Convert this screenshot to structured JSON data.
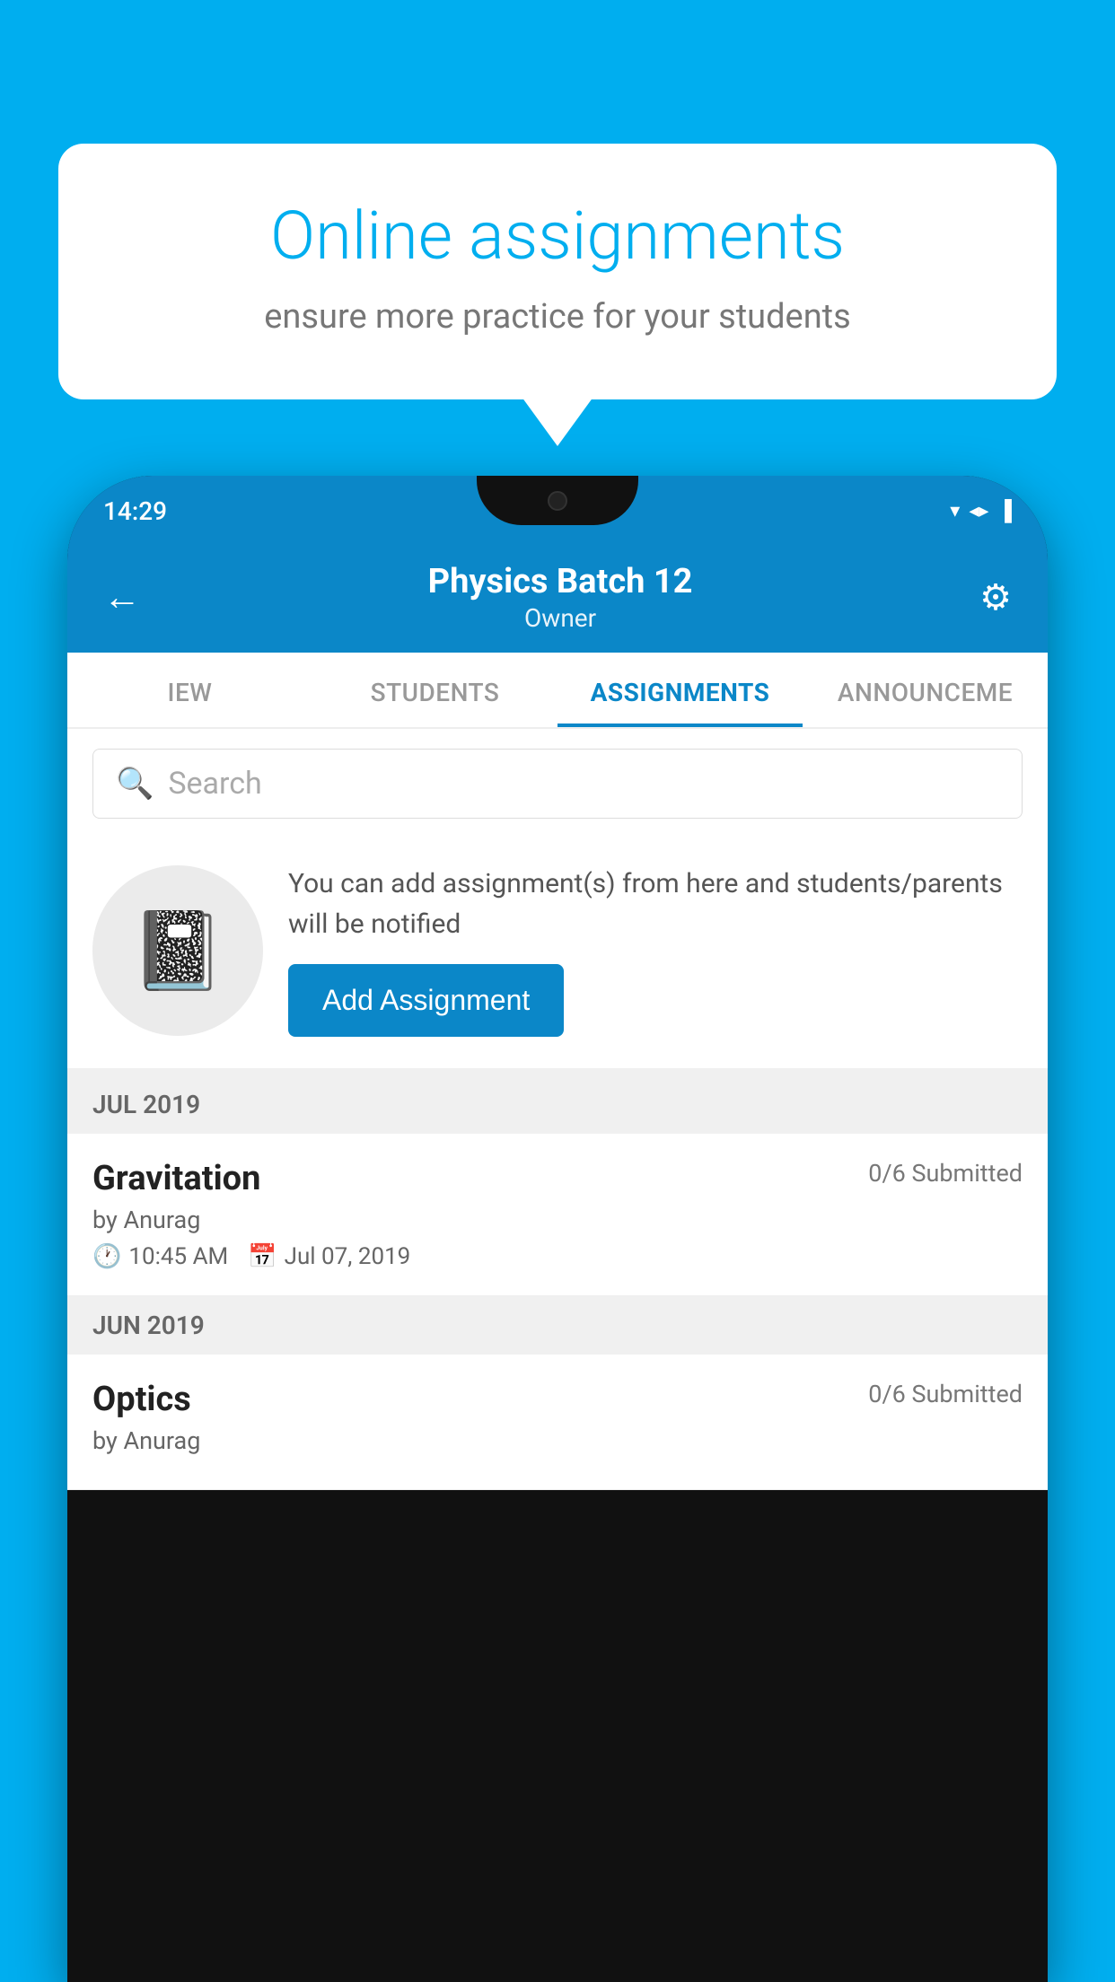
{
  "background": {
    "color": "#00AEEF"
  },
  "speech_bubble": {
    "title": "Online assignments",
    "subtitle": "ensure more practice for your students"
  },
  "phone": {
    "status_bar": {
      "time": "14:29",
      "icons": [
        "▼",
        "◀",
        "▌"
      ]
    },
    "header": {
      "title": "Physics Batch 12",
      "subtitle": "Owner",
      "back_icon": "←",
      "settings_icon": "⚙"
    },
    "tabs": [
      {
        "label": "IEW",
        "active": false
      },
      {
        "label": "STUDENTS",
        "active": false
      },
      {
        "label": "ASSIGNMENTS",
        "active": true
      },
      {
        "label": "ANNOUNCEME",
        "active": false
      }
    ],
    "search": {
      "placeholder": "Search"
    },
    "promo": {
      "description": "You can add assignment(s) from here and students/parents will be notified",
      "button_label": "Add Assignment"
    },
    "sections": [
      {
        "header": "JUL 2019",
        "assignments": [
          {
            "name": "Gravitation",
            "submitted": "0/6 Submitted",
            "author": "by Anurag",
            "time": "10:45 AM",
            "date": "Jul 07, 2019"
          }
        ]
      },
      {
        "header": "JUN 2019",
        "assignments": [
          {
            "name": "Optics",
            "submitted": "0/6 Submitted",
            "author": "by Anurag",
            "time": "",
            "date": ""
          }
        ]
      }
    ]
  }
}
